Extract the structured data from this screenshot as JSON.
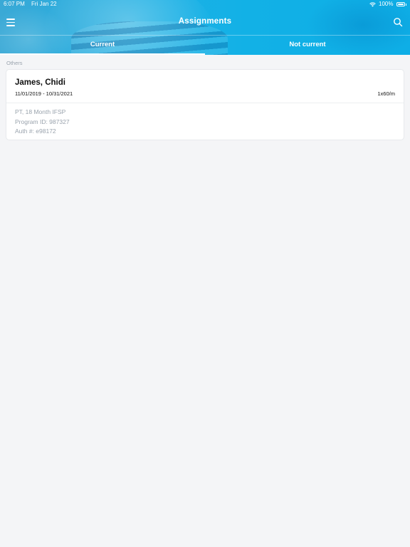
{
  "status_bar": {
    "time": "6:07 PM",
    "date": "Fri Jan 22",
    "battery": "100%",
    "icons": [
      "wifi-icon",
      "battery-icon"
    ]
  },
  "header": {
    "title": "Assignments",
    "menu_icon": "hamburger-menu-icon",
    "search_icon": "search-icon"
  },
  "tabs": [
    {
      "label": "Current",
      "active": true
    },
    {
      "label": "Not current",
      "active": false
    }
  ],
  "section_label": "Others",
  "assignments": [
    {
      "name": "James, Chidi",
      "dates": "11/01/2019 - 10/31/2021",
      "frequency": "1x60/m",
      "details": [
        "PT, 18 Month IFSP",
        "Program ID: 987327",
        "Auth #: e98172"
      ]
    }
  ],
  "colors": {
    "header_blue": "#12b1e6",
    "background": "#f4f5f7",
    "muted_text": "#9aa3ad"
  }
}
